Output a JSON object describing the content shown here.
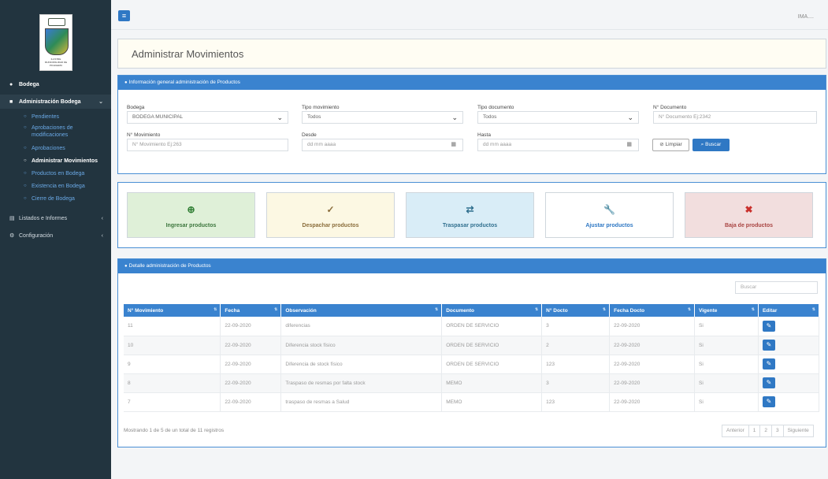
{
  "sidebar": {
    "logo_text": "ILUSTRE MUNICIPALIDAD DE PICHILEMU",
    "logo_banner": "PICHILEMU",
    "bodega": "Bodega",
    "admin_bodega": "Administración Bodega",
    "sub_items": [
      "Pendientes",
      "Aprobaciones de modificaciones",
      "Aprobaciones",
      "Administrar Movimientos",
      "Productos en Bodega",
      "Existencia en Bodega",
      "Cierre de Bodega"
    ],
    "listados": "Listados e Informes",
    "configuracion": "Configuración"
  },
  "topbar": {
    "menu_icon": "≡",
    "user": "IMA...."
  },
  "page": {
    "title": "Administrar Movimientos"
  },
  "filters": {
    "panel_title": "Información general administración de Productos",
    "bodega_label": "Bodega",
    "bodega_value": "BODEGA MUNICIPAL",
    "tipo_mov_label": "Tipo movimiento",
    "tipo_mov_value": "Todos",
    "tipo_doc_label": "Tipo documento",
    "tipo_doc_value": "Todos",
    "num_doc_label": "N° Documento",
    "num_doc_placeholder": "N° Documento Ej:2342",
    "num_mov_label": "N° Movimiento",
    "num_mov_placeholder": "N° Movimiento Ej:263",
    "desde_label": "Desde",
    "desde_placeholder": "dd mm aaaa",
    "hasta_label": "Hasta",
    "hasta_placeholder": "dd mm aaaa",
    "clear_label": "Limpiar",
    "search_label": "Buscar"
  },
  "actions": [
    {
      "label": "Ingresar productos",
      "icon": "plus-circle-icon",
      "glyph": "⊕",
      "bg": "#dff0d8",
      "color": "#3c763d",
      "icon_color": "#2e7d32"
    },
    {
      "label": "Despachar productos",
      "icon": "check-circle-icon",
      "glyph": "✓",
      "bg": "#fcf8e3",
      "color": "#8a6d3b",
      "icon_color": "#8a6d3b"
    },
    {
      "label": "Traspasar productos",
      "icon": "exchange-icon",
      "glyph": "⇄",
      "bg": "#d9edf7",
      "color": "#31708f",
      "icon_color": "#31708f"
    },
    {
      "label": "Ajustar productos",
      "icon": "wrench-icon",
      "glyph": "🔧",
      "bg": "#ffffff",
      "color": "#2f78c4",
      "icon_color": "#2f78c4"
    },
    {
      "label": "Baja de productos",
      "icon": "x-circle-icon",
      "glyph": "✖",
      "bg": "#f2dede",
      "color": "#a94442",
      "icon_color": "#c9302c"
    }
  ],
  "table": {
    "panel_title": "Detalle administración de Productos",
    "search_placeholder": "Buscar",
    "columns": [
      "N° Movimiento",
      "Fecha",
      "Observación",
      "Documento",
      "N° Docto",
      "Fecha Docto",
      "Vigente",
      "Editar"
    ],
    "rows": [
      [
        "11",
        "22-09-2020",
        "diferencias",
        "ORDEN DE SERVICIO",
        "3",
        "22-09-2020",
        "Si"
      ],
      [
        "10",
        "22-09-2020",
        "Diferencia stock físico",
        "ORDEN DE SERVICIO",
        "2",
        "22-09-2020",
        "Si"
      ],
      [
        "9",
        "22-09-2020",
        "Diferencia de stock físico",
        "ORDEN DE SERVICIO",
        "123",
        "22-09-2020",
        "Si"
      ],
      [
        "8",
        "22-09-2020",
        "Traspaso de resmas por falta stock",
        "MEMO",
        "3",
        "22-09-2020",
        "Si"
      ],
      [
        "7",
        "22-09-2020",
        "traspaso de resmas a Salud",
        "MEMO",
        "123",
        "22-09-2020",
        "Si"
      ]
    ],
    "info": "Mostrando 1 de 5 de un total de 11 registros",
    "pager": [
      "Anterior",
      "1",
      "2",
      "3",
      "Siguiente"
    ]
  }
}
